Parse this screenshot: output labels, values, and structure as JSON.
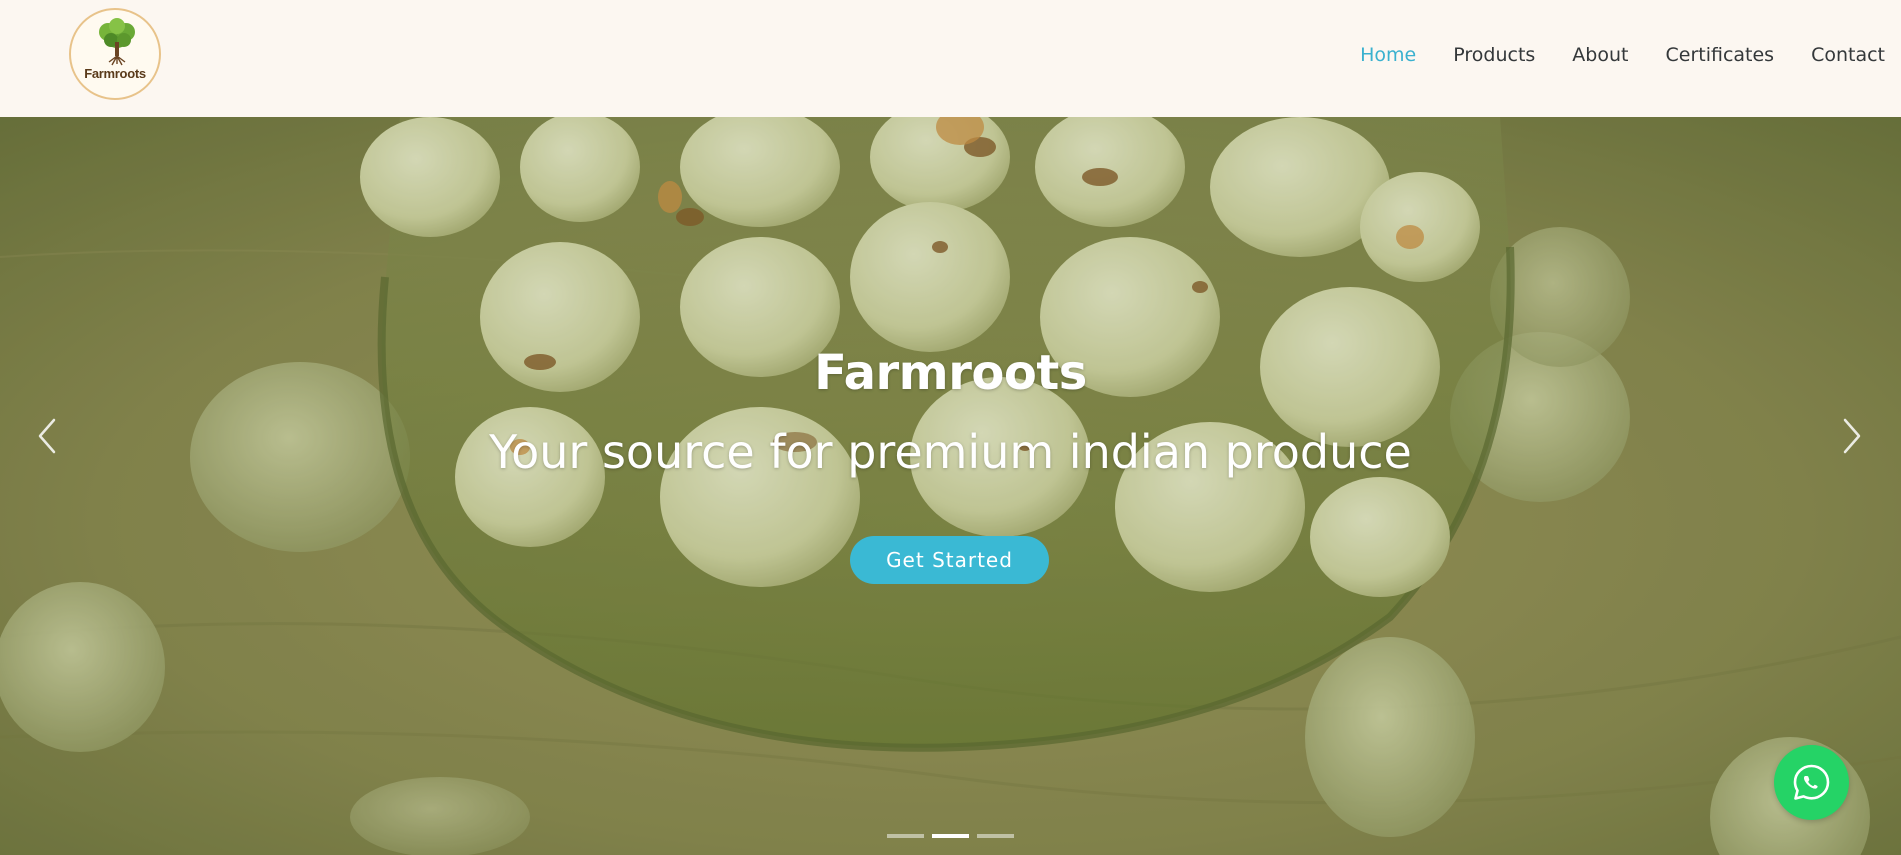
{
  "brand": {
    "logo_text": "Farmroots",
    "logo_icon": "tree-icon"
  },
  "nav": {
    "items": [
      {
        "label": "Home",
        "active": true
      },
      {
        "label": "Products",
        "active": false
      },
      {
        "label": "About",
        "active": false
      },
      {
        "label": "Certificates",
        "active": false
      },
      {
        "label": "Contact",
        "active": false
      }
    ]
  },
  "hero": {
    "title": "Farmroots",
    "subtitle": "Your source for premium indian produce",
    "cta_label": "Get Started",
    "prev_icon": "chevron-left-icon",
    "next_icon": "chevron-right-icon",
    "slide_count": 3,
    "active_slide": 2
  },
  "floating": {
    "whatsapp_icon": "whatsapp-icon"
  },
  "colors": {
    "accent": "#3ab1cf",
    "cta": "#3ab9d4",
    "whatsapp": "#25d366",
    "header_bg": "#fcf7f1",
    "nav_text": "#34383a"
  }
}
